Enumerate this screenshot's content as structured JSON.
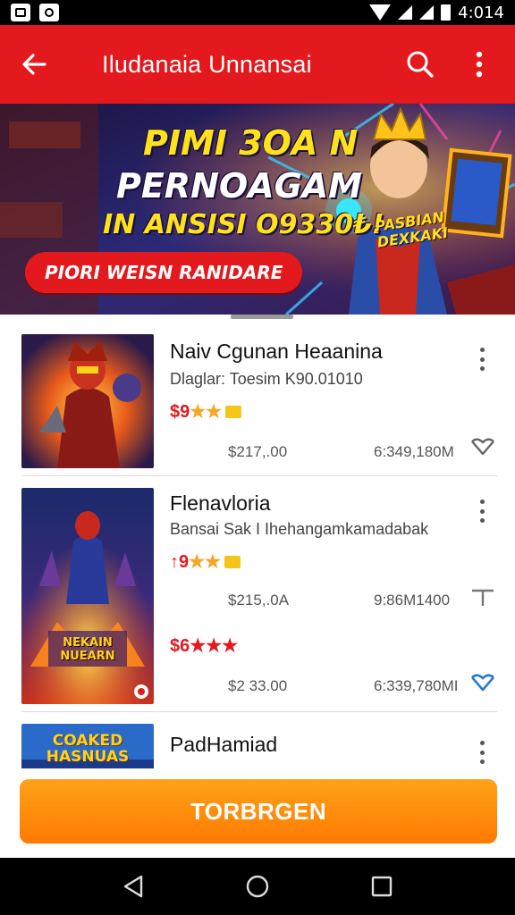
{
  "status_bar": {
    "time": "4:014"
  },
  "app_bar": {
    "title": "Iludanaia Unnansai"
  },
  "banner": {
    "line1": "PIMI 3OA N",
    "line2": "PERNOAGAM",
    "line3": "IN ANSISI O9330₺!",
    "cta": "PIORI WEISN RANIDARE",
    "tag": "PASBIAN DEXKAKI"
  },
  "items": [
    {
      "title": "Naiv Cgunan Heaanina",
      "subtitle": "Dlaglar: Toesim K90.01010",
      "rating_prefix": "$9",
      "stars": "★★",
      "price": "$217,.00",
      "count": "6:349,180M"
    },
    {
      "title": "Flenavloria",
      "subtitle": "Bansai Sak I Ihehangamkamadabak",
      "rating_prefix": "↑9",
      "stars": "★★",
      "price": "$215,.0A",
      "count": "9:86M1400",
      "rating2_prefix": "$6",
      "stars2": "★★★",
      "price2": "$2 33.00",
      "count2": "6:339,780MI"
    },
    {
      "title": "PadHamiad"
    }
  ],
  "thumb3_text": "COAKED HASNUAS",
  "thumb2_text": "NEKAIN NUEARN",
  "cta": {
    "label": "TORBRGEN"
  }
}
